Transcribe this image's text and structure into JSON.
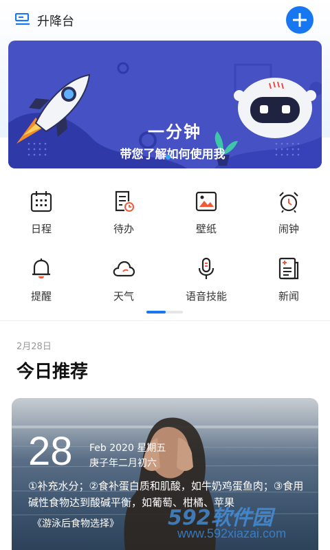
{
  "header": {
    "title": "升降台",
    "menu_icon": "menu-icon",
    "add_icon": "plus-icon",
    "accent": "#1677f0"
  },
  "banner": {
    "line1": "一分钟",
    "line2": "带您了解如何使用我",
    "page_count": 2,
    "active_page": 1,
    "bg": "#4652c4"
  },
  "shortcuts": [
    {
      "label": "日程",
      "icon": "calendar-icon"
    },
    {
      "label": "待办",
      "icon": "todo-icon"
    },
    {
      "label": "壁纸",
      "icon": "wallpaper-icon"
    },
    {
      "label": "闹钟",
      "icon": "alarm-icon"
    },
    {
      "label": "提醒",
      "icon": "bell-icon"
    },
    {
      "label": "天气",
      "icon": "cloud-icon"
    },
    {
      "label": "语音技能",
      "icon": "microphone-icon"
    },
    {
      "label": "新闻",
      "icon": "news-icon"
    }
  ],
  "recommend": {
    "date": "2月28日",
    "title": "今日推荐",
    "card": {
      "day": "28",
      "date_en": "Feb 2020 星期五",
      "date_cn": "庚子年二月初六",
      "tip": "①补充水分；②食补蛋白质和肌酸，如牛奶鸡蛋鱼肉；③食用碱性食物达到酸碱平衡，如葡萄、柑橘、苹果",
      "source": "《游泳后食物选择》"
    }
  },
  "watermark": {
    "text": "592软件园",
    "url": "www.592xiazai.com"
  }
}
